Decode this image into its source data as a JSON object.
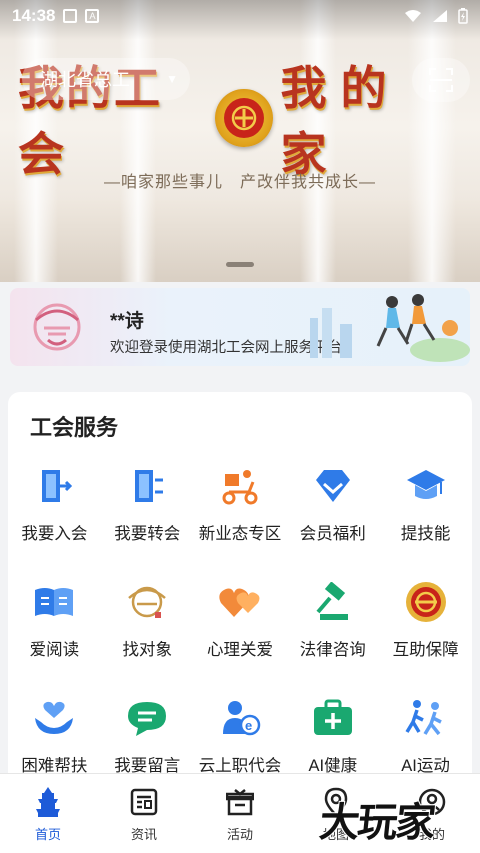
{
  "status_bar": {
    "time": "14:38"
  },
  "banner": {
    "region_label": "湖北省总工",
    "slogan_left": "我的工会",
    "slogan_right": "我的家",
    "subtitle": "—咱家那些事儿　产改伴我共成长—"
  },
  "user_card": {
    "name": "**诗",
    "welcome": "欢迎登录使用湖北工会网上服务平台!"
  },
  "services": {
    "title": "工会服务",
    "items": [
      {
        "label": "我要入会",
        "icon": "door-enter-icon"
      },
      {
        "label": "我要转会",
        "icon": "door-transfer-icon"
      },
      {
        "label": "新业态专区",
        "icon": "delivery-rider-icon"
      },
      {
        "label": "会员福利",
        "icon": "diamond-icon"
      },
      {
        "label": "提技能",
        "icon": "graduation-cap-icon"
      },
      {
        "label": "爱阅读",
        "icon": "open-book-icon"
      },
      {
        "label": "找对象",
        "icon": "matchmaking-emblem-icon"
      },
      {
        "label": "心理关爱",
        "icon": "hearts-icon"
      },
      {
        "label": "法律咨询",
        "icon": "gavel-icon"
      },
      {
        "label": "互助保障",
        "icon": "union-badge-icon"
      },
      {
        "label": "困难帮扶",
        "icon": "helping-hands-icon"
      },
      {
        "label": "我要留言",
        "icon": "chat-bubble-icon"
      },
      {
        "label": "云上职代会",
        "icon": "online-conference-icon"
      },
      {
        "label": "AI健康",
        "icon": "medical-kit-icon"
      },
      {
        "label": "AI运动",
        "icon": "runners-icon"
      }
    ]
  },
  "bottom_nav": {
    "items": [
      {
        "label": "首页",
        "icon": "home-pagoda-icon",
        "active": true
      },
      {
        "label": "资讯",
        "icon": "news-icon",
        "active": false
      },
      {
        "label": "活动",
        "icon": "gift-box-icon",
        "active": false
      },
      {
        "label": "地图",
        "icon": "map-pin-icon",
        "active": false
      },
      {
        "label": "我的",
        "icon": "profile-icon",
        "active": false
      }
    ]
  },
  "watermark": "大玩家",
  "colors": {
    "accent": "#1e5bd8",
    "slogan_red": "#b8341f",
    "icon_blue": "#2f7be8"
  }
}
